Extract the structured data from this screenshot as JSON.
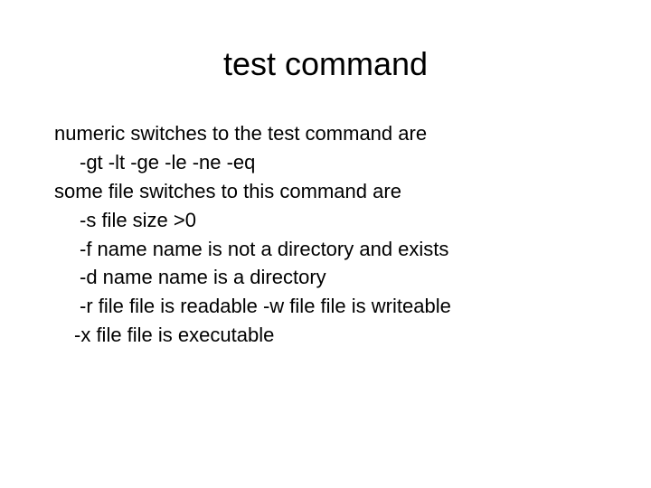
{
  "title": "test command",
  "lines": {
    "l0": "numeric switches to the test command are",
    "l1": "-gt  -lt  -ge  -le  -ne  -eq",
    "l2": "some file switches to this command are",
    "l3": "-s file   size >0",
    "l4": "-f  name    name is not a directory and exists",
    "l5": "-d name    name is a directory",
    "l6": "-r  file  file is readable   -w  file file is writeable",
    "l7": "-x   file      file is executable"
  }
}
